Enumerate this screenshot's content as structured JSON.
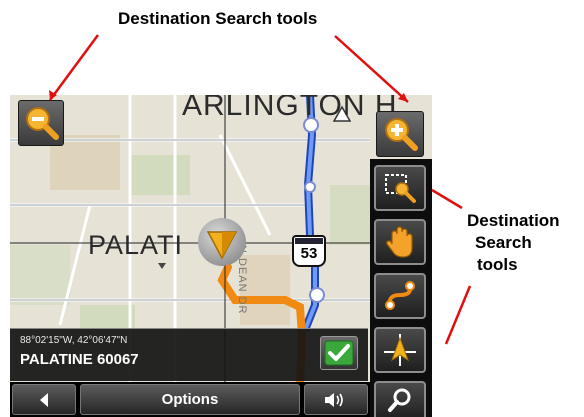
{
  "annotations": {
    "top_caption": "Destination Search tools",
    "right_caption_lines": [
      "Destination",
      "Search",
      "tools"
    ]
  },
  "map": {
    "labels": {
      "city_north": "ARLINGTON H",
      "city_west": "PALATI",
      "street": "N DEAN DR",
      "highway_shield": "53"
    },
    "route_color": "#f08a12",
    "highway_color": "#3a6fe0"
  },
  "location_panel": {
    "coordinates": "88°02'15\"W, 42°06'47\"N",
    "place": "PALATINE 60067"
  },
  "bottom_bar": {
    "options_label": "Options"
  },
  "icons": {
    "zoom_out": "zoom-out-icon",
    "zoom_in": "zoom-in-icon",
    "select_area": "select-area-zoom-icon",
    "pan": "hand-pan-icon",
    "route": "route-icon",
    "position": "position-arrow-icon",
    "search": "search-icon",
    "back": "back-arrow-icon",
    "volume": "volume-icon",
    "confirm": "checkmark-icon"
  },
  "colors": {
    "annotation_arrow": "#e01010",
    "confirm_green": "#3aa83a",
    "zoom_icon_orange": "#f0a020"
  }
}
